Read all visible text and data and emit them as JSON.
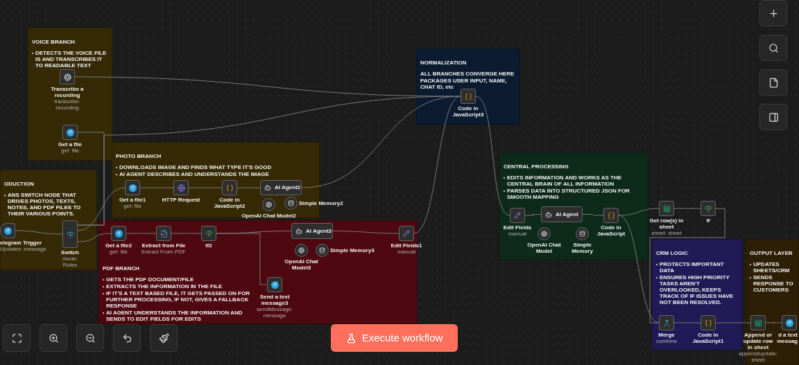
{
  "canvas": {
    "sticky_notes": [
      {
        "title": "VOICE BRANCH",
        "bullets": [
          "DETECTS THE VOICE FILE IS AND TRANSCRIBES IT TO READABLE TEXT"
        ],
        "color": "#352a05"
      },
      {
        "title": "ODUCTION",
        "bullets": [
          "ANS SWITCH NODE THAT DRIVES PHOTOS, TEXTS, NOTES, AND PDF FILES TO THEIR VARIOUS POINTS."
        ],
        "color": "#352a05"
      },
      {
        "title": "PHOTO BRANCH",
        "bullets": [
          "DOWNLOADS IMAGE AND FINDS WHAT TYPE IT'S GOOD",
          "AI AGENT DESCRIBES AND UNDERSTANDS THE IMAGE"
        ],
        "color": "#352a05"
      },
      {
        "title": "PDF BRANCH",
        "bullets": [
          "GETS THE PDF DOCUMENT/FILE",
          "EXTRACTS THE INFORMATION IN THE FILE",
          "IF IT'S A TEXT BASED FILE, IT GETS PASSED ON FOR FURTHER PROCESSING, IF NOT, GIVES A FALLBACK RESPONSE",
          "AI AGENT UNDERSTANDS THE INFORMATION AND SENDS TO EDIT FIELDS FOR EDITS"
        ],
        "color": "#4d0810"
      },
      {
        "title": "NORMALIZATION",
        "bullets": [
          "ALL BRANCHES CONVERGE HERE",
          "PACKAGES USER INPUT, NAME, CHAT ID, etc"
        ],
        "plain": true,
        "color": "#0b1c30"
      },
      {
        "title": "CENTRAL PROCESSING",
        "bullets": [
          "EDITS INFORMATION AND WORKS AS THE CENTRAL BRAIN OF ALL INFORMATION",
          "PARSES DATA INTO STRUCTURED JSON FOR SMOOTH MAPPING"
        ],
        "color": "#0d2a1b"
      },
      {
        "title": "CRM LOGIC",
        "bullets": [
          "PROTECTS IMPORTANT DATA",
          "ENSURES HIGH PRIORITY TASKS AREN'T OVERLOOKED, KEEPS TRACK OF IF ISSUES HAVE NOT BEEN RESOLVED."
        ],
        "color": "#221a56"
      },
      {
        "title": "OUTPUT LAYER",
        "bullets": [
          "UPDATES SHEETS/CRM",
          "SENDS RESPONSE TO CUSTOMERS"
        ],
        "color": "#2c1f05"
      }
    ],
    "nodes": [
      {
        "label": "Transcribe a recording",
        "subtitle": "transcribe: recording",
        "kind": "openai"
      },
      {
        "label": "Get a file",
        "subtitle": "get: file",
        "kind": "telegram"
      },
      {
        "label": "elegram Trigger",
        "subtitle": "Updates: message",
        "kind": "trigger"
      },
      {
        "label": "Switch",
        "subtitle": "mode: Rules",
        "kind": "switch"
      },
      {
        "label": "Get a file1",
        "subtitle": "get: file",
        "kind": "telegram"
      },
      {
        "label": "HTTP Request",
        "kind": "http"
      },
      {
        "label": "Code in JavaScript2",
        "kind": "code"
      },
      {
        "label": "AI Agent2",
        "kind": "agent"
      },
      {
        "label": "OpenAI Chat Model2",
        "kind": "model"
      },
      {
        "label": "Simple Memory2",
        "kind": "memory"
      },
      {
        "label": "Get a file2",
        "subtitle": "get: file",
        "kind": "telegram"
      },
      {
        "label": "Extract from File",
        "subtitle": "Extract From PDF",
        "kind": "extract"
      },
      {
        "label": "If2",
        "kind": "if"
      },
      {
        "label": "AI Agent3",
        "kind": "agent"
      },
      {
        "label": "OpenAI Chat Model3",
        "kind": "model"
      },
      {
        "label": "Simple Memory3",
        "kind": "memory"
      },
      {
        "label": "Send a text message3",
        "subtitle": "sendMessage: message",
        "kind": "telegram"
      },
      {
        "label": "Edit Fields1",
        "subtitle": "manual",
        "kind": "edit"
      },
      {
        "label": "Code in JavaScript3",
        "kind": "code"
      },
      {
        "label": "Edit Fields",
        "subtitle": "manual",
        "kind": "edit"
      },
      {
        "label": "AI Agent",
        "kind": "agent"
      },
      {
        "label": "OpenAI Chat Model",
        "kind": "model"
      },
      {
        "label": "Simple Memory",
        "kind": "memory"
      },
      {
        "label": "Code in JavaScript",
        "kind": "code"
      },
      {
        "label": "Get row(s) in sheet",
        "subtitle": "sheet: sheet",
        "kind": "sheets"
      },
      {
        "label": "If",
        "kind": "if"
      },
      {
        "label": "Merge",
        "subtitle": "combine",
        "kind": "merge"
      },
      {
        "label": "Code in JavaScript1",
        "kind": "code"
      },
      {
        "label": "Append or update row in sheet",
        "subtitle": "append/update: sheet",
        "kind": "sheets"
      },
      {
        "label": "d a text messag",
        "kind": "telegram"
      }
    ]
  },
  "execute_button": {
    "label": "Execute workflow"
  }
}
